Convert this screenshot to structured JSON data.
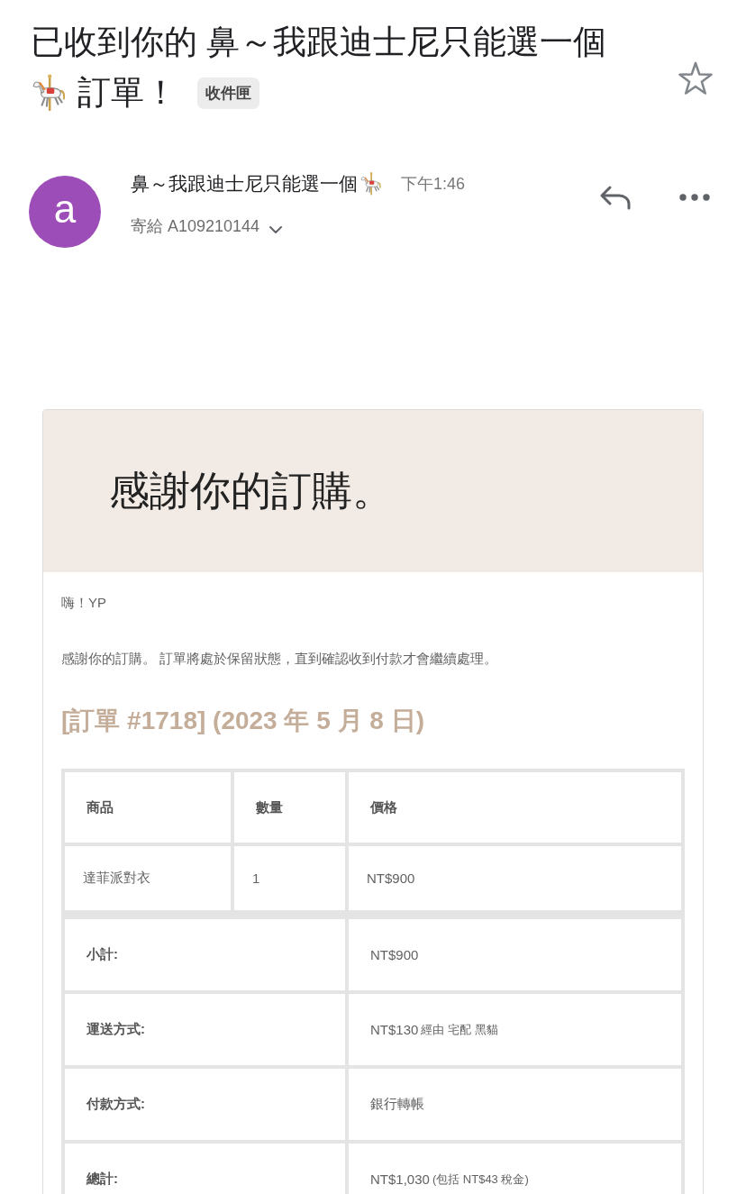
{
  "subject": {
    "text_before_icon": "已收到你的 鼻～我跟迪士尼只能選一個",
    "text_after_icon": "訂單！",
    "label": "收件匣",
    "starred": false
  },
  "message": {
    "avatar_letter": "a",
    "sender": "鼻～我跟迪士尼只能選一個",
    "time": "下午1:46",
    "recipient": "寄給 A109210144"
  },
  "email_body": {
    "banner_title": "感謝你的訂購。",
    "greeting": "嗨！YP",
    "intro": "感謝你的訂購。 訂單將處於保留狀態，直到確認收到付款才會繼續處理。",
    "order_heading": "[訂單 #1718] (2023 年 5 月 8 日)",
    "order_table": {
      "columns": [
        "商品",
        "數量",
        "價格"
      ],
      "rows": [
        {
          "cells": [
            "達菲派對衣",
            "1",
            "NT$900"
          ]
        }
      ],
      "totals": [
        {
          "label": "小計:",
          "value": "NT$900"
        },
        {
          "label": "運送方式:",
          "value": "NT$130",
          "note": "經由 宅配 黑貓"
        },
        {
          "label": "付款方式:",
          "value": "銀行轉帳"
        },
        {
          "label": "總計:",
          "value": "NT$1,030",
          "note": "(包括 NT$43 稅金)"
        }
      ]
    }
  }
}
